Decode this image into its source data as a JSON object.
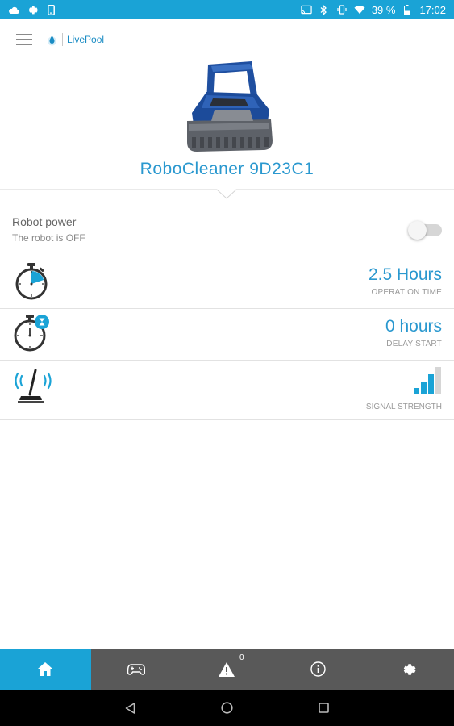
{
  "status_bar": {
    "battery_percent": "39 %",
    "time": "17:02"
  },
  "app": {
    "brand_name": "LivePool"
  },
  "robot": {
    "name": "RoboCleaner 9D23C1"
  },
  "power": {
    "title": "Robot power",
    "status": "The robot is OFF",
    "toggle_on": false
  },
  "operation": {
    "value": "2.5 Hours",
    "label": "OPERATION TIME"
  },
  "delay": {
    "value": "0 hours",
    "label": "DELAY START"
  },
  "signal": {
    "label": "SIGNAL STRENGTH",
    "level": 3,
    "max_level": 4
  },
  "bottom_nav": {
    "alerts_badge": "0",
    "items": [
      "home-icon",
      "gamepad-icon",
      "warning-icon",
      "info-icon",
      "settings-icon"
    ],
    "active": "home-icon"
  },
  "colors": {
    "accent": "#1aa3d6",
    "value_text": "#2a98cf",
    "nav_bg": "#595959"
  }
}
